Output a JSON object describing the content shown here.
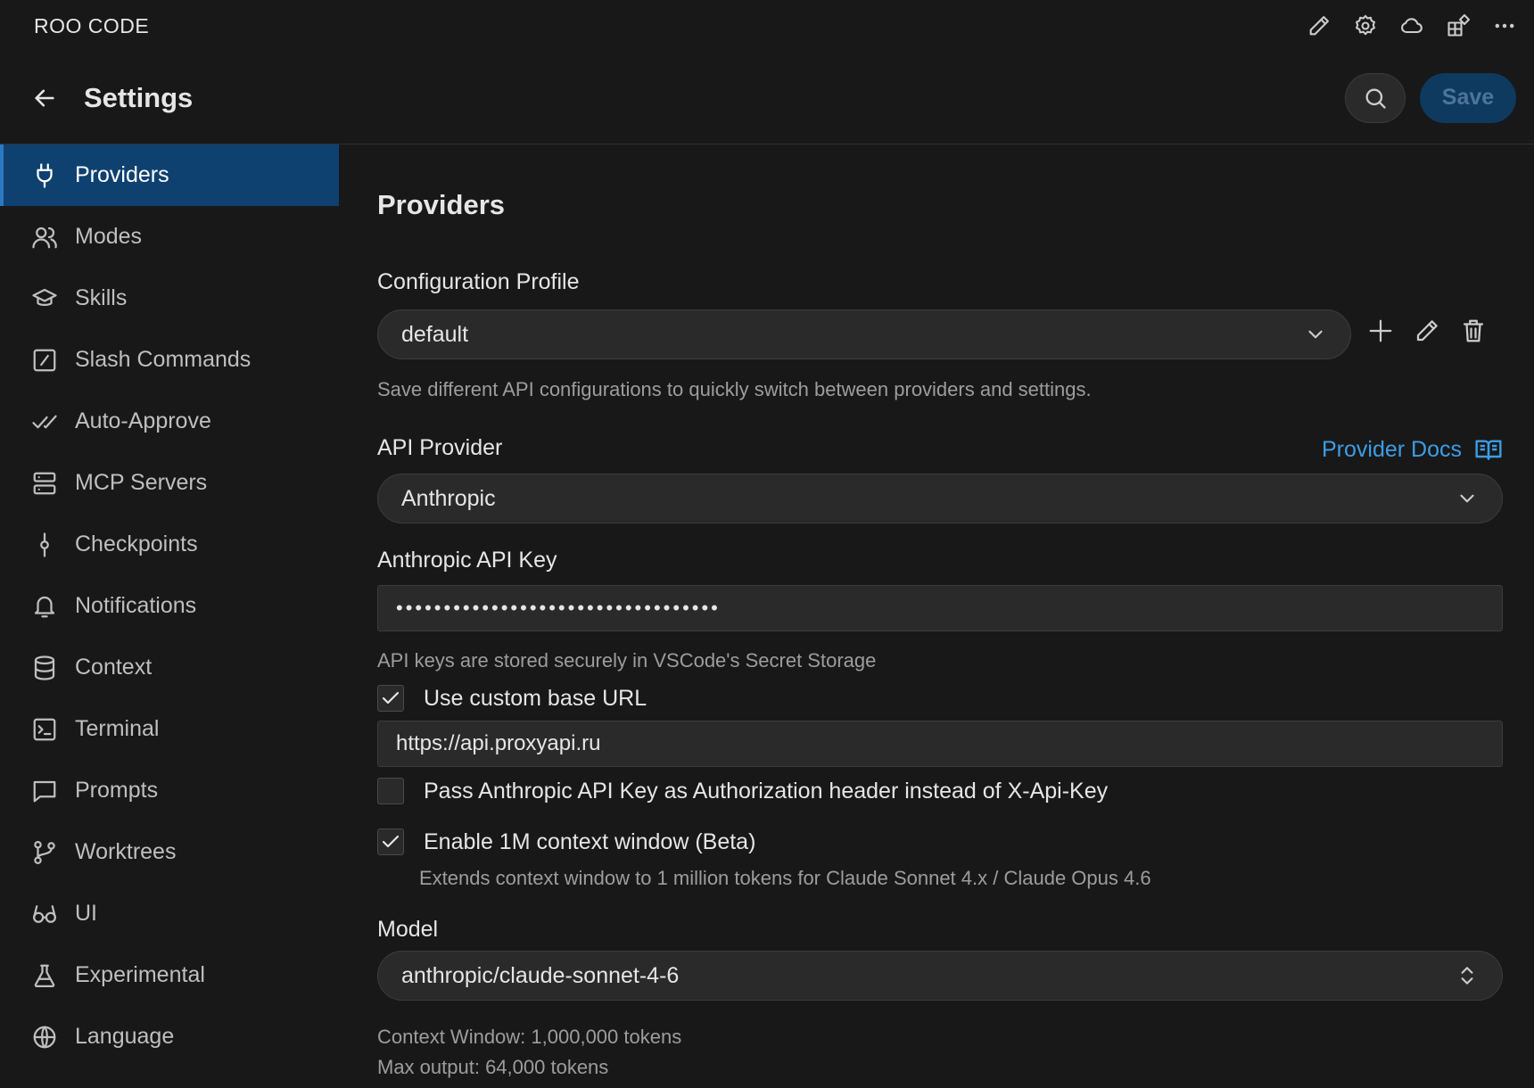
{
  "app_title": "ROO CODE",
  "header": {
    "title": "Settings",
    "save_label": "Save"
  },
  "sidebar": {
    "items": [
      {
        "label": "Providers"
      },
      {
        "label": "Modes"
      },
      {
        "label": "Skills"
      },
      {
        "label": "Slash Commands"
      },
      {
        "label": "Auto-Approve"
      },
      {
        "label": "MCP Servers"
      },
      {
        "label": "Checkpoints"
      },
      {
        "label": "Notifications"
      },
      {
        "label": "Context"
      },
      {
        "label": "Terminal"
      },
      {
        "label": "Prompts"
      },
      {
        "label": "Worktrees"
      },
      {
        "label": "UI"
      },
      {
        "label": "Experimental"
      },
      {
        "label": "Language"
      }
    ]
  },
  "main": {
    "section_title": "Providers",
    "config_profile": {
      "label": "Configuration Profile",
      "value": "default",
      "helper": "Save different API configurations to quickly switch between providers and settings."
    },
    "api_provider": {
      "label": "API Provider",
      "value": "Anthropic",
      "docs_label": "Provider Docs"
    },
    "api_key": {
      "label": "Anthropic API Key",
      "value": "••••••••••••••••••••••••••••••••••",
      "helper": "API keys are stored securely in VSCode's Secret Storage"
    },
    "custom_base_url": {
      "label": "Use custom base URL",
      "checked": true,
      "value": "https://api.proxyapi.ru"
    },
    "auth_header": {
      "label": "Pass Anthropic API Key as Authorization header instead of X-Api-Key",
      "checked": false
    },
    "context_1m": {
      "label": "Enable 1M context window (Beta)",
      "checked": true,
      "helper": "Extends context window to 1 million tokens for Claude Sonnet 4.x / Claude Opus 4.6"
    },
    "model": {
      "label": "Model",
      "value": "anthropic/claude-sonnet-4-6",
      "context_window": "Context Window: 1,000,000 tokens",
      "max_output": "Max output: 64,000 tokens"
    }
  }
}
